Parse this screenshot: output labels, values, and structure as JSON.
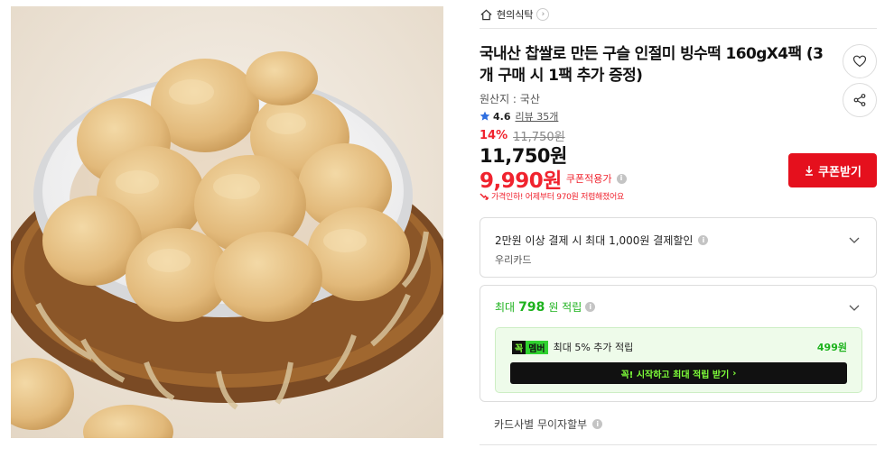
{
  "store": {
    "name": "현의식탁"
  },
  "product": {
    "title": "국내산 찹쌀로 만든 구슬 인절미 빙수떡 160gX4팩 (3개 구매 시 1팩 추가 증정)",
    "origin": "원산지 : 국산",
    "rating": "4.6",
    "review_label": "리뷰 35개"
  },
  "price": {
    "discount_rate": "14%",
    "original": "11,750원",
    "sale": "11,750원",
    "coupon_price": "9,990원",
    "coupon_applied_label": "쿠폰적용가",
    "price_drop_note": "가격인하! 어제부터 970원 저렴해졌어요",
    "coupon_button": "쿠폰받기"
  },
  "card_discount": {
    "text": "2만원 이상 결제 시 최대 1,000원 결제할인",
    "card": "우리카드"
  },
  "points": {
    "prefix": "최대",
    "amount": "798",
    "suffix": "원 적립",
    "badge_k": "꼭",
    "badge_m": "멤버",
    "member_text": "최대 5% 추가 적립",
    "member_points": "499원",
    "cta": "꼭! 시작하고 최대 적립 받기"
  },
  "installment": {
    "text": "카드사별 무이자할부"
  },
  "colors": {
    "accent": "#e5101d",
    "sale_red": "#f0232e",
    "point_green": "#1db21d"
  },
  "icons": [
    "home-icon",
    "chevron-right-icon",
    "heart-icon",
    "share-icon",
    "star-icon",
    "info-icon",
    "download-icon",
    "chevron-down-icon",
    "price-down-arrow-icon"
  ]
}
